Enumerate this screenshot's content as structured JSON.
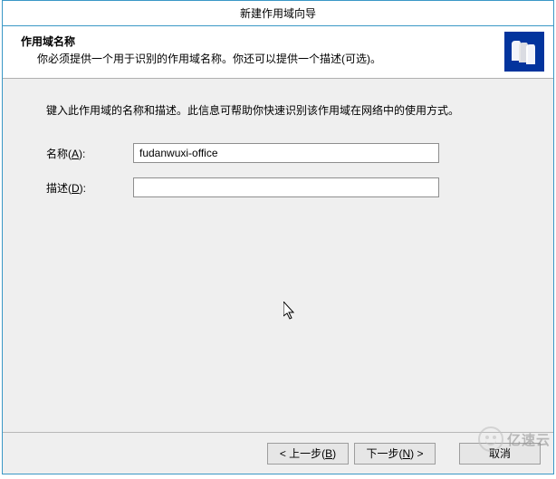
{
  "window": {
    "title": "新建作用域向导"
  },
  "header": {
    "title": "作用域名称",
    "subtitle": "你必须提供一个用于识别的作用域名称。你还可以提供一个描述(可选)。",
    "icon": "scope-books-icon"
  },
  "content": {
    "intro": "键入此作用域的名称和描述。此信息可帮助你快速识别该作用域在网络中的使用方式。"
  },
  "form": {
    "name_label_pre": "名称(",
    "name_label_key": "A",
    "name_label_post": "):",
    "name_value": "fudanwuxi-office",
    "desc_label_pre": "描述(",
    "desc_label_key": "D",
    "desc_label_post": "):",
    "desc_value": ""
  },
  "buttons": {
    "back_pre": "< 上一步(",
    "back_key": "B",
    "back_post": ")",
    "next_pre": "下一步(",
    "next_key": "N",
    "next_post": ") >",
    "cancel": "取消"
  },
  "watermark": {
    "text": "亿速云"
  }
}
